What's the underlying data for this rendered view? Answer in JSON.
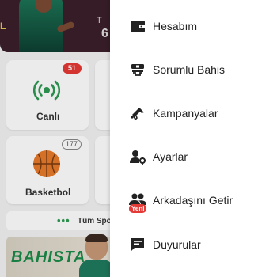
{
  "background": {
    "hero_left_fragment": "L",
    "hero_right_label": "T",
    "hero_right_number": "6",
    "live_card": {
      "label": "Canlı",
      "badge": "51"
    },
    "basketball_card": {
      "label": "Basketbol",
      "badge": "177"
    },
    "all_sports": {
      "dots": "•••",
      "label": "Tüm Spo"
    },
    "promo": {
      "brand": "BAHISTA"
    }
  },
  "drawer": {
    "items": [
      {
        "label": "Hesabım",
        "icon": "wallet-icon"
      },
      {
        "label": "Sorumlu Bahis",
        "icon": "responsible-betting-icon"
      },
      {
        "label": "Kampanyalar",
        "icon": "megaphone-icon"
      },
      {
        "label": "Ayarlar",
        "icon": "user-settings-icon"
      },
      {
        "label": "Arkadaşını Getir",
        "icon": "group-icon",
        "badge": "Yeni"
      },
      {
        "label": "Duyurular",
        "icon": "announcement-icon"
      }
    ]
  },
  "colors": {
    "accent_green": "#2e9a52",
    "badge_red": "#e53935",
    "icon_dark": "#222222"
  }
}
